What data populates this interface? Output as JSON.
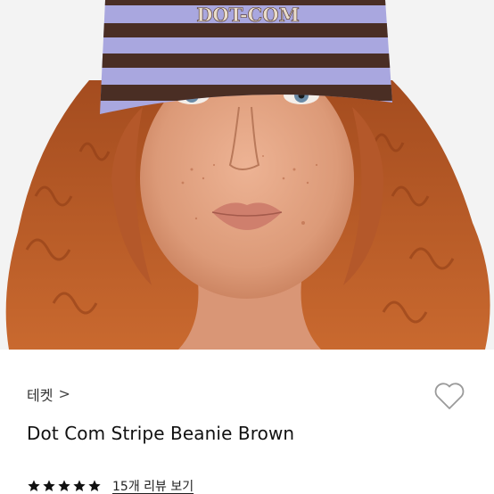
{
  "product": {
    "image_alt": "model wearing striped beanie",
    "beanie_text": "DOT-COM",
    "brand": "테켓",
    "brand_chevron": ">",
    "title": "Dot Com Stripe Beanie Brown",
    "rating": 5,
    "rating_max": 5,
    "review_link": "15개 리뷰 보기"
  },
  "icons": {
    "wishlist": "heart-outline-icon",
    "star": "star-filled-icon",
    "chevron": "chevron-right-icon"
  },
  "colors": {
    "beanie_lilac": "#a9a7df",
    "beanie_brown": "#4a2e24",
    "hair": "#b85a28",
    "skin": "#e4a585",
    "star": "#111111"
  }
}
